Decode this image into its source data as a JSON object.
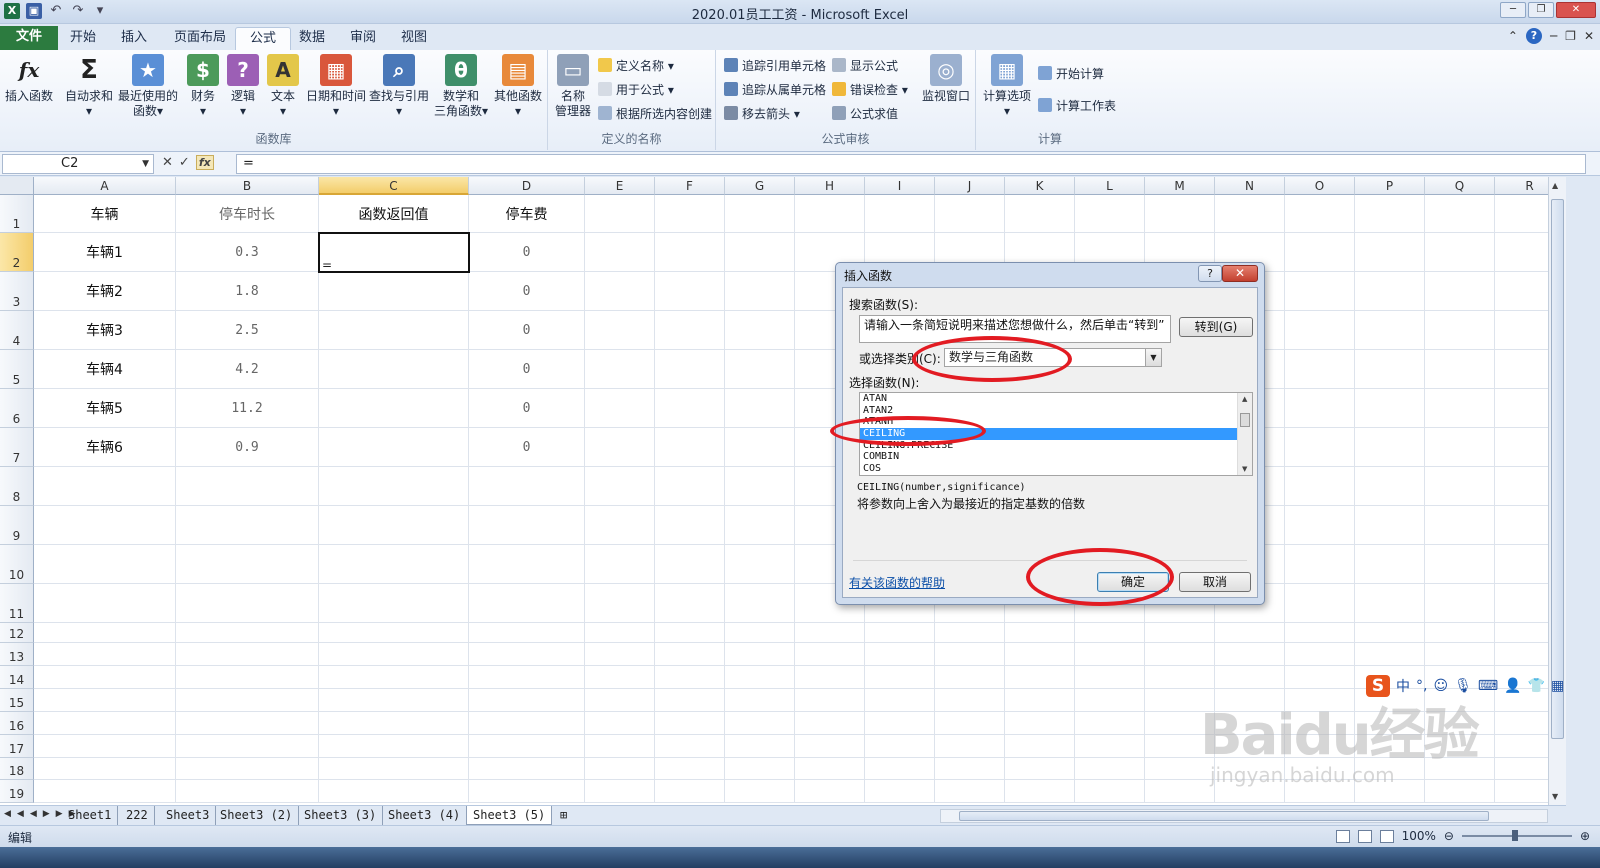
{
  "window": {
    "title": "2020.01员工工资 - Microsoft Excel"
  },
  "tabs": {
    "file": "文件",
    "items": [
      "开始",
      "插入",
      "页面布局",
      "公式",
      "数据",
      "审阅",
      "视图"
    ],
    "active": "公式"
  },
  "ribbon": {
    "library": {
      "label": "函数库",
      "insert_function": "插入函数",
      "autosum": "自动求和",
      "recent_1": "最近使用的",
      "recent_2": "函数",
      "financial": "财务",
      "logical": "逻辑",
      "text": "文本",
      "datetime": "日期和时间",
      "lookup": "查找与引用",
      "math_1": "数学和",
      "math_2": "三角函数",
      "more": "其他函数"
    },
    "names": {
      "label": "定义的名称",
      "manager_1": "名称",
      "manager_2": "管理器",
      "define": "定义名称",
      "use_in_formula": "用于公式",
      "create_from_selection": "根据所选内容创建"
    },
    "audit": {
      "label": "公式审核",
      "trace_precedents": "追踪引用单元格",
      "trace_dependents": "追踪从属单元格",
      "remove_arrows": "移去箭头",
      "show_formulas": "显示公式",
      "error_check": "错误检查",
      "evaluate": "公式求值",
      "watch": "监视窗口"
    },
    "calc": {
      "label": "计算",
      "options": "计算选项",
      "calc_now": "开始计算",
      "calc_sheet": "计算工作表"
    }
  },
  "formula_bar": {
    "name_box": "C2",
    "formula": "="
  },
  "grid": {
    "columns": [
      "A",
      "B",
      "C",
      "D",
      "E",
      "F",
      "G",
      "H",
      "I",
      "J",
      "K",
      "L",
      "M",
      "N",
      "O",
      "P",
      "Q",
      "R"
    ],
    "rows": [
      "1",
      "2",
      "3",
      "4",
      "5",
      "6",
      "7",
      "8",
      "9",
      "10",
      "11",
      "12",
      "13",
      "14",
      "15",
      "16",
      "17",
      "18",
      "19"
    ],
    "header": [
      "车辆",
      "停车时长",
      "函数返回值",
      "停车费"
    ],
    "data": [
      {
        "vehicle": "车辆1",
        "duration": "0.3",
        "fee": "0"
      },
      {
        "vehicle": "车辆2",
        "duration": "1.8",
        "fee": "0"
      },
      {
        "vehicle": "车辆3",
        "duration": "2.5",
        "fee": "0"
      },
      {
        "vehicle": "车辆4",
        "duration": "4.2",
        "fee": "0"
      },
      {
        "vehicle": "车辆5",
        "duration": "11.2",
        "fee": "0"
      },
      {
        "vehicle": "车辆6",
        "duration": "0.9",
        "fee": "0"
      }
    ],
    "active_cell_value": "="
  },
  "sheets": {
    "tabs": [
      "Sheet1",
      "222",
      "Sheet3",
      "Sheet3 (2)",
      "Sheet3 (3)",
      "Sheet3 (4)",
      "Sheet3 (5)"
    ],
    "active": "Sheet3 (5)"
  },
  "status": {
    "mode": "编辑",
    "zoom": "100%"
  },
  "dialog": {
    "title": "插入函数",
    "search_label": "搜索函数(S):",
    "search_text": "请输入一条简短说明来描述您想做什么，然后单击“转到”",
    "go_button": "转到(G)",
    "category_label": "或选择类别(C):",
    "category_value": "数学与三角函数",
    "function_list_label": "选择函数(N):",
    "functions": [
      "ATAN",
      "ATAN2",
      "ATANH",
      "CEILING",
      "CEILING.PRECISE",
      "COMBIN",
      "COS"
    ],
    "selected_function": "CEILING",
    "signature": "CEILING(number,significance)",
    "description": "将参数向上舍入为最接近的指定基数的倍数",
    "help_link": "有关该函数的帮助",
    "ok_button": "确定",
    "cancel_button": "取消"
  },
  "ime": {
    "lang": "中"
  },
  "watermark": {
    "brand": "Baidu经验",
    "url": "jingyan.baidu.com"
  },
  "colors": {
    "file_tab": "#2c7b3f",
    "selection": "#3399ff",
    "annotation": "#e21b22"
  }
}
